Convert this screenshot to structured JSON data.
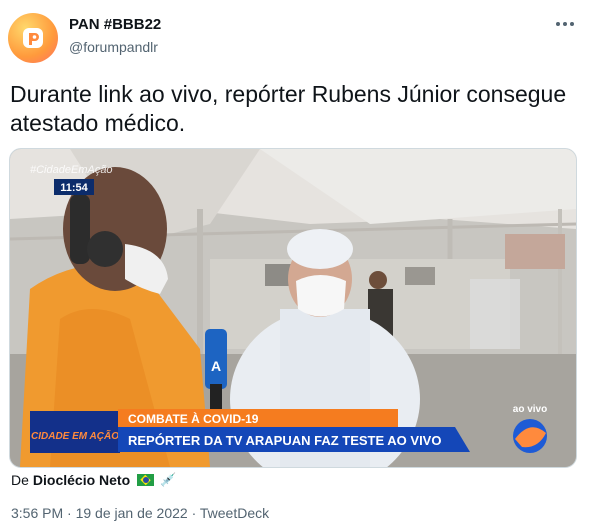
{
  "author": {
    "name": "PAN #BBB22",
    "handle": "@forumpandlr"
  },
  "tweet": {
    "text": "Durante link ao vivo, repórter Rubens Júnior consegue atestado médico."
  },
  "video": {
    "clock": "11:54",
    "channel_tag": "#CidadeEmAção",
    "lower_third_top": "COMBATE À COVID-19",
    "lower_third_bottom": "REPÓRTER DA TV ARAPUAN FAZ TESTE AO VIVO",
    "show_logo": "CIDADE EM AÇÃO",
    "live_label": "ao vivo",
    "mic_label": "A"
  },
  "attribution": {
    "prefix": "De",
    "name": "Dioclécio Neto"
  },
  "meta": {
    "text": "3:56 PM · 19 de jan de 2022 · TweetDeck"
  },
  "icons": [
    "more-icon",
    "flag-icon",
    "syringe-icon"
  ]
}
